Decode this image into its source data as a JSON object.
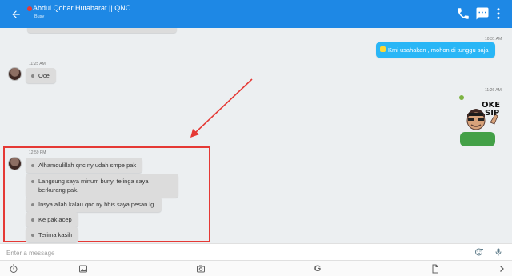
{
  "header": {
    "title": "Abdul Qohar Hutabarat || QNC",
    "subtitle": "Busy",
    "colors": {
      "appbar": "#1e88e5",
      "status": "#e53935"
    },
    "icons": [
      "back-arrow-icon",
      "phone-icon",
      "chat-menu-icon",
      "more-vert-icon"
    ]
  },
  "messages": {
    "top_clipped": "· · ·",
    "out1": {
      "time": "10:31 AM",
      "text": "Kmi usahakan , mohon di tunggu saja"
    },
    "in1": {
      "time": "11:25 AM",
      "text": "Oce"
    },
    "sticker": {
      "time": "11:26 AM",
      "text": "OKE SIP"
    },
    "group": {
      "time": "12:59 PM",
      "items": [
        "Alhamdulillah qnc ny udah smpe pak",
        "Langsung saya minum bunyi telinga saya berkurang pak.",
        "Insya allah kalau qnc ny hbis saya pesan lg.",
        "Ke pak acep",
        "Terima kasih"
      ]
    }
  },
  "composer": {
    "placeholder": "Enter a message",
    "icons": [
      "emoji-add-icon",
      "microphone-icon"
    ]
  },
  "toolbar": {
    "icons": [
      "timer-icon",
      "image-icon",
      "camera-icon",
      "google-icon",
      "file-icon",
      "chevron-right-icon"
    ],
    "google_label": "G"
  }
}
